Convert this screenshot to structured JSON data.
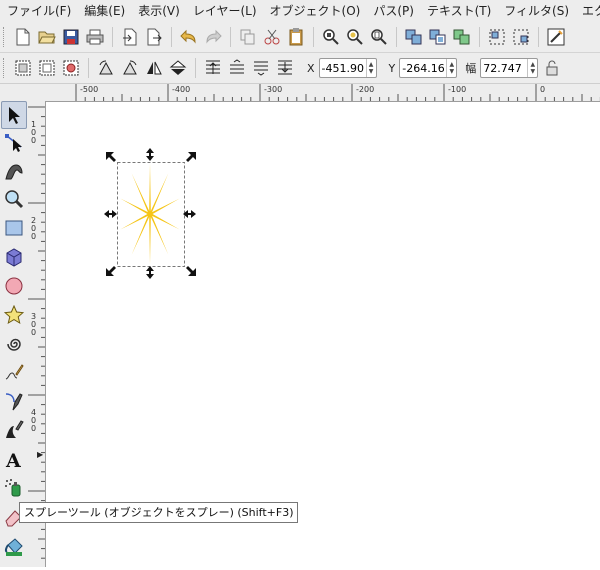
{
  "menu": [
    "ファイル(F)",
    "編集(E)",
    "表示(V)",
    "レイヤー(L)",
    "オブジェクト(O)",
    "パス(P)",
    "テキスト(T)",
    "フィルタ(S)",
    "エク"
  ],
  "coords": {
    "x_label": "X",
    "x_value": "-451.90",
    "y_label": "Y",
    "y_value": "-264.16",
    "w_label": "幅",
    "w_value": "72.747"
  },
  "hruler_labels": [
    "-500",
    "-400",
    "-300",
    "-200",
    "-100",
    "0"
  ],
  "vruler_labels": [
    "1 0 0",
    "2 0 0",
    "3 0 0",
    "4 0 0",
    "5"
  ],
  "tooltip": "スプレーツール (オブジェクトをスプレー) (Shift+F3)",
  "star_color": "#f5c518",
  "tools": [
    "selector-icon",
    "node-icon",
    "tweak-icon",
    "zoom-icon",
    "rect-icon",
    "3dbox-icon",
    "ellipse-icon",
    "star-icon",
    "spiral-icon",
    "pencil-icon",
    "pen-icon",
    "calligraphy-icon",
    "text-icon",
    "spray-icon",
    "eraser-icon",
    "bucket-icon"
  ]
}
